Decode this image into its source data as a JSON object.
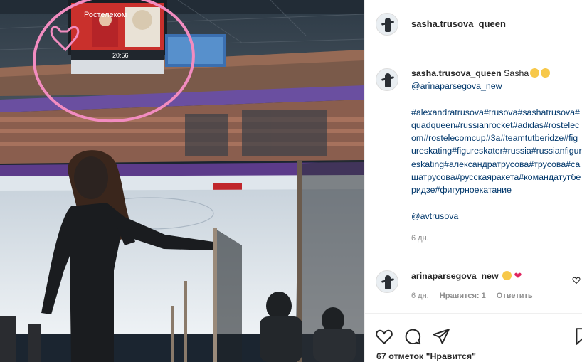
{
  "post": {
    "author": "sasha.trusova_queen",
    "scoreboard": {
      "banner": "Ростелеком",
      "clock": "20:56"
    }
  },
  "caption": {
    "username": "sasha.trusova_queen",
    "text": "Sasha",
    "emojis": [
      "smiling-face-emoji",
      "smiling-face-emoji"
    ],
    "mention": "@arinaparsegova_new",
    "hashtags": "#alexandratrusova#trusova#sashatrusova#quadqueen#russianrocket#adidas#rostelecom#rostelecomcup#3a#teamtutberidze#figureskating#figureskater#russia#russianfigureskating#александратрусова#трусова#сашатрусова#русскаяракета#командатутберидзе#фигурноекатание",
    "mention2": "@avtrusova",
    "time": "6 дн."
  },
  "comment": {
    "username": "arinaparsegova_new",
    "emojis": [
      "hugging-face-emoji",
      "red-heart-emoji"
    ],
    "time": "6 дн.",
    "likes": "Нравится: 1",
    "reply": "Ответить"
  },
  "actions": {
    "likes_count": "67 отметок \"Нравится\""
  },
  "colors": {
    "link": "#00376b",
    "muted": "#8e8e8e",
    "text": "#262626",
    "highlight_circle": "#f28cc0"
  }
}
